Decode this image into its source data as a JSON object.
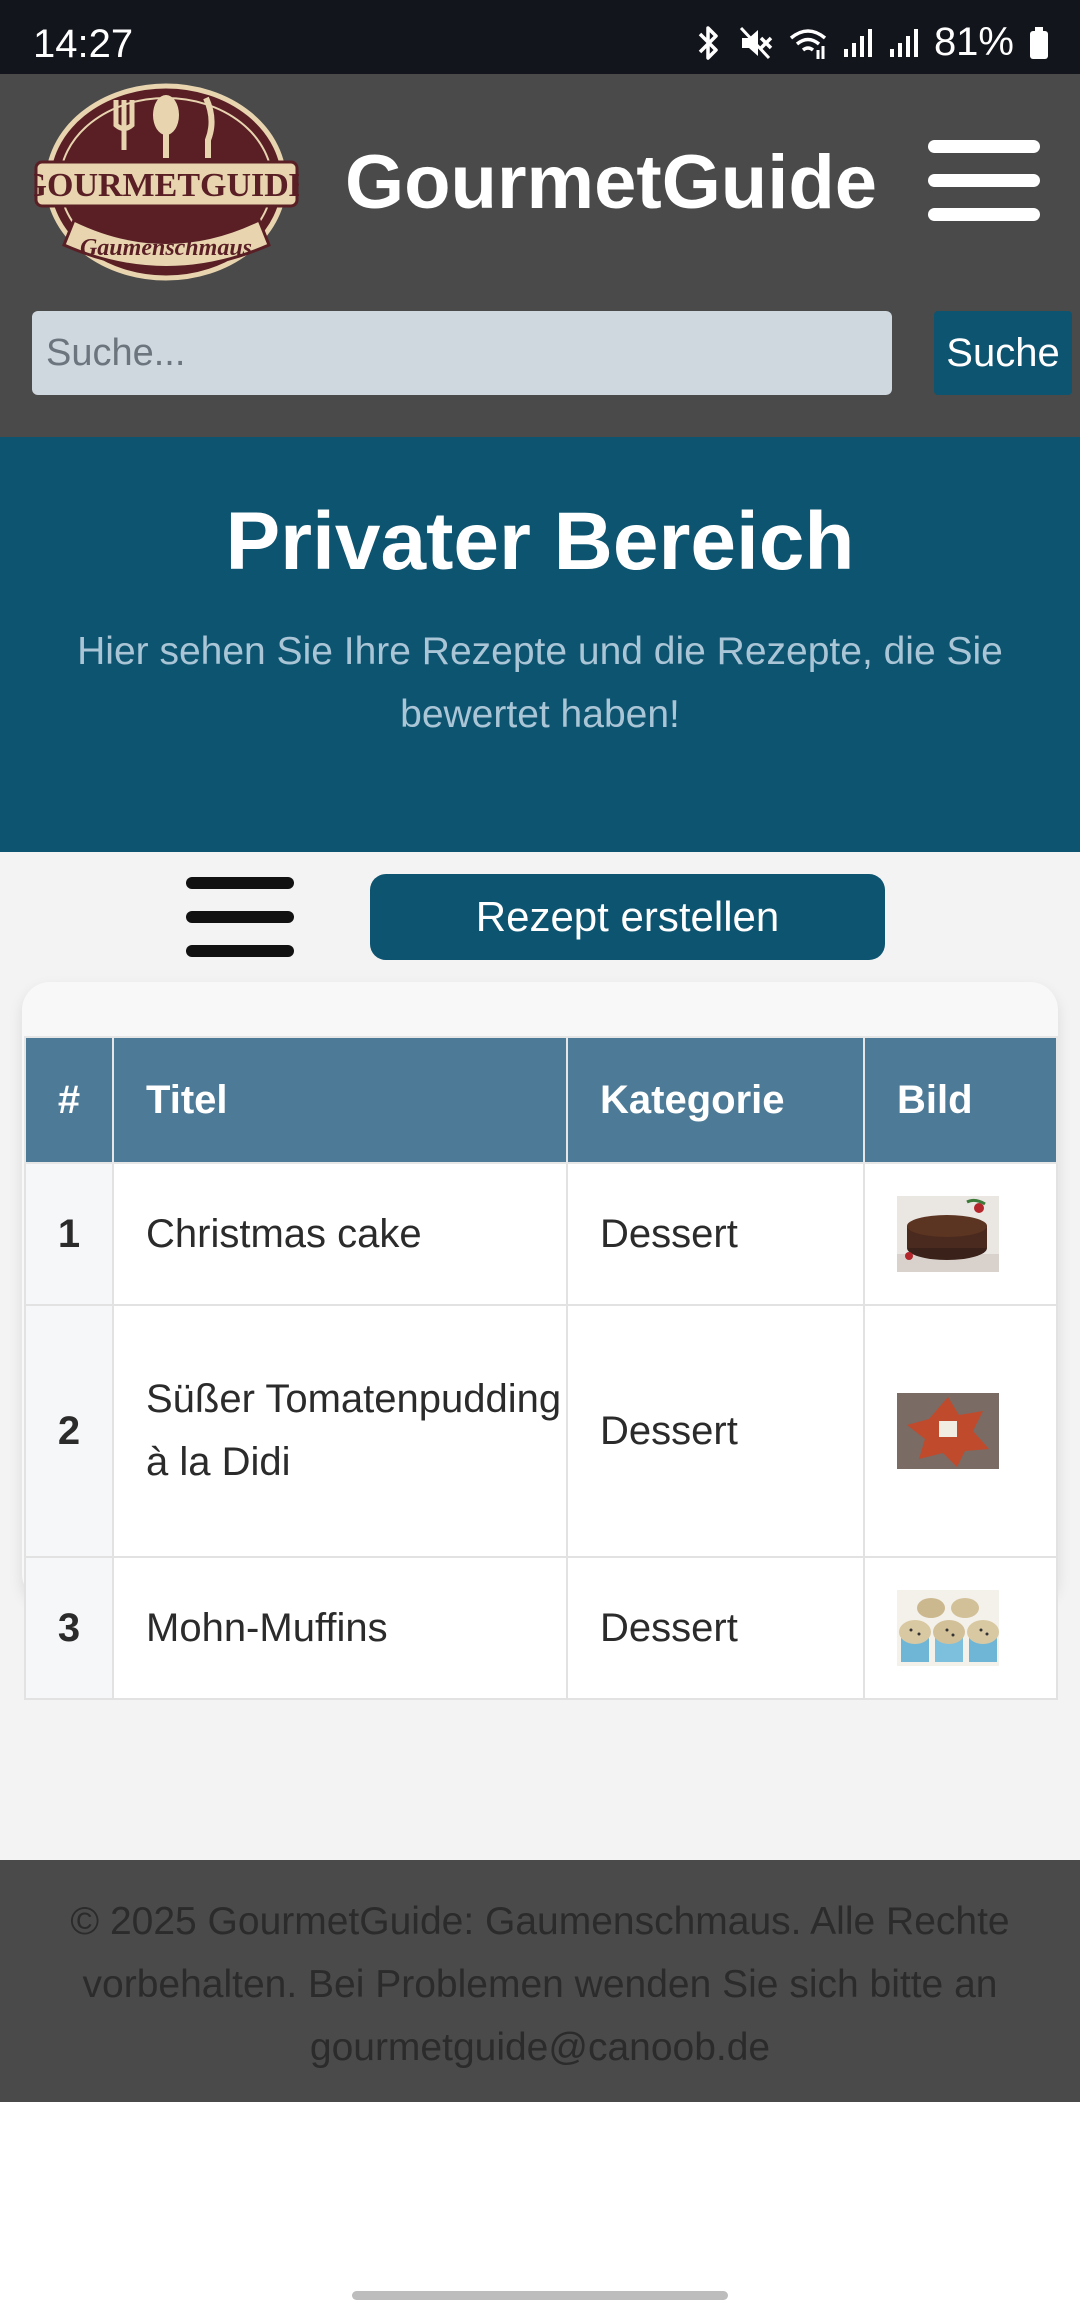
{
  "status_bar": {
    "time": "14:27",
    "battery": "81%"
  },
  "header": {
    "logo_text": "GOURMETGUIDE",
    "logo_subtext": "Gaumenschmaus",
    "brand": "GourmetGuide",
    "search_placeholder": "Suche...",
    "search_button": "Suche"
  },
  "hero": {
    "title": "Privater Bereich",
    "subtitle": "Hier sehen Sie Ihre Rezepte und die Rezepte, die Sie bewertet haben!"
  },
  "actions": {
    "create_recipe": "Rezept erstellen"
  },
  "table": {
    "headers": [
      "#",
      "Titel",
      "Kategorie",
      "Bild"
    ],
    "rows": [
      {
        "num": "1",
        "title": "Christmas cake",
        "category": "Dessert",
        "image": "christmas-cake-thumbnail"
      },
      {
        "num": "2",
        "title": "Süßer Tomatenpudding à la Didi",
        "category": "Dessert",
        "image": "tomato-pudding-thumbnail"
      },
      {
        "num": "3",
        "title": "Mohn-Muffins",
        "category": "Dessert",
        "image": "poppyseed-muffins-thumbnail"
      }
    ]
  },
  "footer": {
    "text": "© 2025 GourmetGuide: Gaumenschmaus. Alle Rechte vorbehalten. Bei Problemen wenden Sie sich bitte an gourmetguide@canoob.de"
  },
  "colors": {
    "header_bg": "#4a4a4a",
    "primary": "#0d5470",
    "table_header": "#4d7a96",
    "main_bg": "#f3f3f3"
  }
}
